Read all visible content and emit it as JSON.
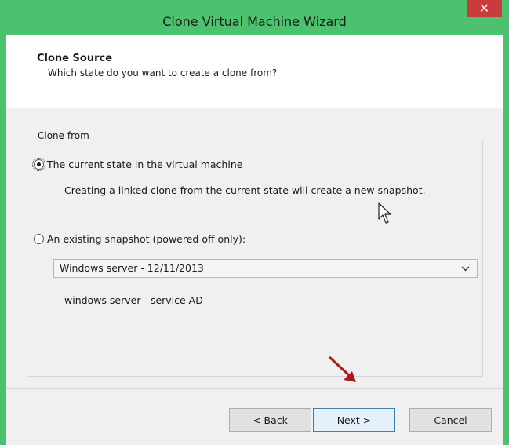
{
  "window": {
    "title": "Clone Virtual Machine Wizard",
    "close_glyph": "✕"
  },
  "header": {
    "title": "Clone Source",
    "subtitle": "Which state do you want to create a clone from?"
  },
  "group": {
    "legend": "Clone from",
    "option_current": {
      "label": "The current state in the virtual machine",
      "selected": true,
      "description": "Creating a linked clone from the current state will create a new snapshot."
    },
    "option_snapshot": {
      "label": "An existing snapshot (powered off only):",
      "selected": false
    },
    "snapshot_select": {
      "value": "Windows server - 12/11/2013"
    },
    "snapshot_description": "windows server - service AD"
  },
  "buttons": {
    "back": "< Back",
    "next": "Next >",
    "cancel": "Cancel"
  },
  "colors": {
    "titlebar": "#4cc26e",
    "close": "#c83c3c",
    "annotation_arrow": "#b01818"
  },
  "icons": [
    "close-icon",
    "chevron-down-icon",
    "mouse-pointer-icon",
    "annotation-arrow-icon"
  ]
}
